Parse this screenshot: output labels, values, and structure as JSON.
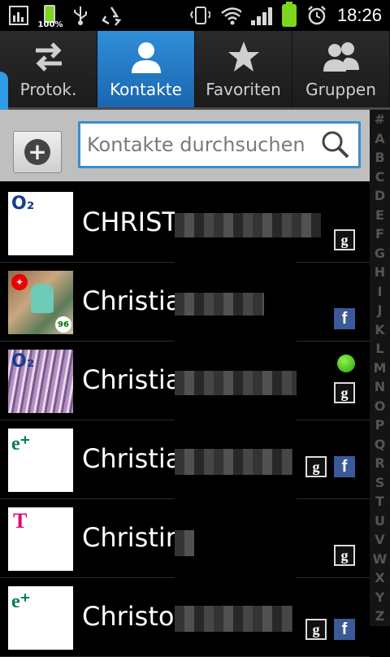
{
  "status_bar": {
    "battery_label": "100%",
    "time": "18:26",
    "left_icons": [
      "chart-icon",
      "battery-small-icon",
      "usb-icon",
      "recycle-icon"
    ],
    "right_icons": [
      "vibrate-icon",
      "wifi-icon",
      "signal-icon",
      "battery-icon",
      "alarm-icon"
    ]
  },
  "tabs": [
    {
      "label": "Protok.",
      "icon": "swap-arrows-icon",
      "active": false
    },
    {
      "label": "Kontakte",
      "icon": "person-icon",
      "active": true
    },
    {
      "label": "Favoriten",
      "icon": "star-icon",
      "active": false
    },
    {
      "label": "Gruppen",
      "icon": "group-icon",
      "active": false
    }
  ],
  "search": {
    "placeholder": "Kontakte durchsuchen",
    "value": ""
  },
  "alpha_index": [
    "#",
    "A",
    "B",
    "C",
    "D",
    "E",
    "F",
    "G",
    "H",
    "I",
    "J",
    "K",
    "L",
    "M",
    "N",
    "O",
    "P",
    "Q",
    "R",
    "S",
    "T",
    "U",
    "V",
    "W",
    "X",
    "Y",
    "Z"
  ],
  "contacts": [
    {
      "name": "CHRISTI",
      "photo": "o2-logo",
      "photo_text": "O₂",
      "accounts": [
        "google"
      ]
    },
    {
      "name": "Christian",
      "photo": "person-photo",
      "photo_text": "96",
      "accounts": [
        "facebook"
      ]
    },
    {
      "name": "Christian",
      "photo": "o2-photo",
      "photo_text": "O₂",
      "accounts": [
        "google"
      ],
      "online": true
    },
    {
      "name": "Christian",
      "photo": "eplus-logo",
      "photo_text": "e⁺",
      "accounts": [
        "google",
        "facebook"
      ]
    },
    {
      "name": "Christin",
      "photo": "telekom-logo",
      "photo_text": "T",
      "accounts": [
        "google"
      ]
    },
    {
      "name": "Christop",
      "photo": "eplus-logo",
      "photo_text": "e⁺",
      "accounts": [
        "google",
        "facebook"
      ]
    }
  ],
  "colors": {
    "active_tab": "#2178c4",
    "search_border": "#3a8ecb",
    "online": "#3bbf1a",
    "facebook": "#3b5998",
    "o2": "#1a3e8c",
    "eplus": "#007a5e",
    "telekom": "#e20074"
  }
}
